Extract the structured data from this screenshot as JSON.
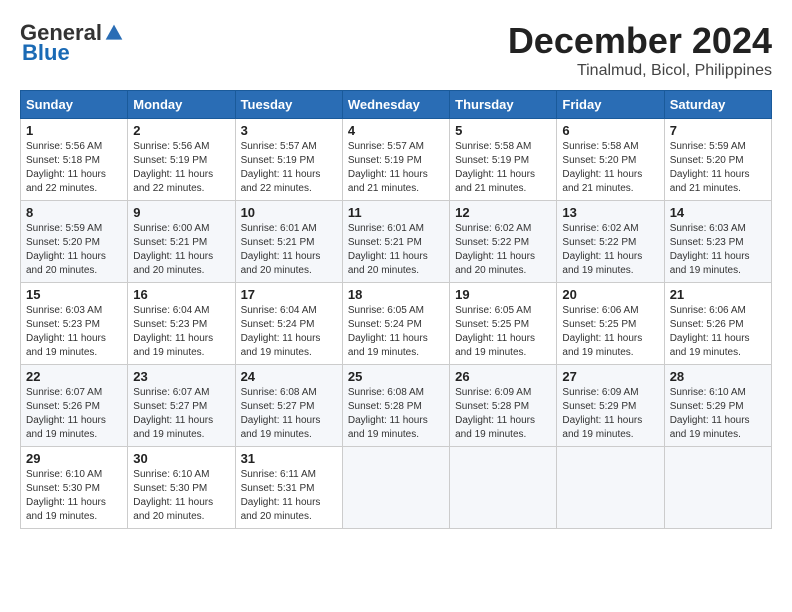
{
  "header": {
    "logo_general": "General",
    "logo_blue": "Blue",
    "month": "December 2024",
    "location": "Tinalmud, Bicol, Philippines"
  },
  "weekdays": [
    "Sunday",
    "Monday",
    "Tuesday",
    "Wednesday",
    "Thursday",
    "Friday",
    "Saturday"
  ],
  "weeks": [
    [
      {
        "day": "1",
        "info": "Sunrise: 5:56 AM\nSunset: 5:18 PM\nDaylight: 11 hours\nand 22 minutes."
      },
      {
        "day": "2",
        "info": "Sunrise: 5:56 AM\nSunset: 5:19 PM\nDaylight: 11 hours\nand 22 minutes."
      },
      {
        "day": "3",
        "info": "Sunrise: 5:57 AM\nSunset: 5:19 PM\nDaylight: 11 hours\nand 22 minutes."
      },
      {
        "day": "4",
        "info": "Sunrise: 5:57 AM\nSunset: 5:19 PM\nDaylight: 11 hours\nand 21 minutes."
      },
      {
        "day": "5",
        "info": "Sunrise: 5:58 AM\nSunset: 5:19 PM\nDaylight: 11 hours\nand 21 minutes."
      },
      {
        "day": "6",
        "info": "Sunrise: 5:58 AM\nSunset: 5:20 PM\nDaylight: 11 hours\nand 21 minutes."
      },
      {
        "day": "7",
        "info": "Sunrise: 5:59 AM\nSunset: 5:20 PM\nDaylight: 11 hours\nand 21 minutes."
      }
    ],
    [
      {
        "day": "8",
        "info": "Sunrise: 5:59 AM\nSunset: 5:20 PM\nDaylight: 11 hours\nand 20 minutes."
      },
      {
        "day": "9",
        "info": "Sunrise: 6:00 AM\nSunset: 5:21 PM\nDaylight: 11 hours\nand 20 minutes."
      },
      {
        "day": "10",
        "info": "Sunrise: 6:01 AM\nSunset: 5:21 PM\nDaylight: 11 hours\nand 20 minutes."
      },
      {
        "day": "11",
        "info": "Sunrise: 6:01 AM\nSunset: 5:21 PM\nDaylight: 11 hours\nand 20 minutes."
      },
      {
        "day": "12",
        "info": "Sunrise: 6:02 AM\nSunset: 5:22 PM\nDaylight: 11 hours\nand 20 minutes."
      },
      {
        "day": "13",
        "info": "Sunrise: 6:02 AM\nSunset: 5:22 PM\nDaylight: 11 hours\nand 19 minutes."
      },
      {
        "day": "14",
        "info": "Sunrise: 6:03 AM\nSunset: 5:23 PM\nDaylight: 11 hours\nand 19 minutes."
      }
    ],
    [
      {
        "day": "15",
        "info": "Sunrise: 6:03 AM\nSunset: 5:23 PM\nDaylight: 11 hours\nand 19 minutes."
      },
      {
        "day": "16",
        "info": "Sunrise: 6:04 AM\nSunset: 5:23 PM\nDaylight: 11 hours\nand 19 minutes."
      },
      {
        "day": "17",
        "info": "Sunrise: 6:04 AM\nSunset: 5:24 PM\nDaylight: 11 hours\nand 19 minutes."
      },
      {
        "day": "18",
        "info": "Sunrise: 6:05 AM\nSunset: 5:24 PM\nDaylight: 11 hours\nand 19 minutes."
      },
      {
        "day": "19",
        "info": "Sunrise: 6:05 AM\nSunset: 5:25 PM\nDaylight: 11 hours\nand 19 minutes."
      },
      {
        "day": "20",
        "info": "Sunrise: 6:06 AM\nSunset: 5:25 PM\nDaylight: 11 hours\nand 19 minutes."
      },
      {
        "day": "21",
        "info": "Sunrise: 6:06 AM\nSunset: 5:26 PM\nDaylight: 11 hours\nand 19 minutes."
      }
    ],
    [
      {
        "day": "22",
        "info": "Sunrise: 6:07 AM\nSunset: 5:26 PM\nDaylight: 11 hours\nand 19 minutes."
      },
      {
        "day": "23",
        "info": "Sunrise: 6:07 AM\nSunset: 5:27 PM\nDaylight: 11 hours\nand 19 minutes."
      },
      {
        "day": "24",
        "info": "Sunrise: 6:08 AM\nSunset: 5:27 PM\nDaylight: 11 hours\nand 19 minutes."
      },
      {
        "day": "25",
        "info": "Sunrise: 6:08 AM\nSunset: 5:28 PM\nDaylight: 11 hours\nand 19 minutes."
      },
      {
        "day": "26",
        "info": "Sunrise: 6:09 AM\nSunset: 5:28 PM\nDaylight: 11 hours\nand 19 minutes."
      },
      {
        "day": "27",
        "info": "Sunrise: 6:09 AM\nSunset: 5:29 PM\nDaylight: 11 hours\nand 19 minutes."
      },
      {
        "day": "28",
        "info": "Sunrise: 6:10 AM\nSunset: 5:29 PM\nDaylight: 11 hours\nand 19 minutes."
      }
    ],
    [
      {
        "day": "29",
        "info": "Sunrise: 6:10 AM\nSunset: 5:30 PM\nDaylight: 11 hours\nand 19 minutes."
      },
      {
        "day": "30",
        "info": "Sunrise: 6:10 AM\nSunset: 5:30 PM\nDaylight: 11 hours\nand 20 minutes."
      },
      {
        "day": "31",
        "info": "Sunrise: 6:11 AM\nSunset: 5:31 PM\nDaylight: 11 hours\nand 20 minutes."
      },
      {
        "day": "",
        "info": ""
      },
      {
        "day": "",
        "info": ""
      },
      {
        "day": "",
        "info": ""
      },
      {
        "day": "",
        "info": ""
      }
    ]
  ]
}
